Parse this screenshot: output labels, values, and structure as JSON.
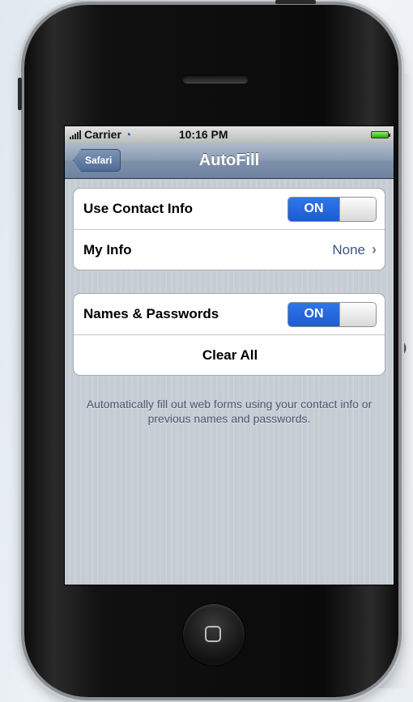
{
  "status_bar": {
    "carrier": "Carrier",
    "time": "10:16 PM",
    "signal_icon": "signal-bars-icon",
    "wifi_icon": "wifi-icon",
    "battery_icon": "battery-icon"
  },
  "nav": {
    "back_label": "Safari",
    "title": "AutoFill"
  },
  "section1": {
    "use_contact_info": {
      "label": "Use Contact Info",
      "toggle": "ON"
    },
    "my_info": {
      "label": "My Info",
      "value": "None",
      "chevron": "›"
    }
  },
  "section2": {
    "names_passwords": {
      "label": "Names & Passwords",
      "toggle": "ON"
    },
    "clear_all": {
      "label": "Clear All"
    }
  },
  "footnote": "Automatically fill out web forms using your contact info or previous names and passwords.",
  "colors": {
    "accent": "#1d5bd0",
    "navbar": "#6d83a1",
    "value_text": "#385487",
    "background": "#c5ccd4"
  }
}
